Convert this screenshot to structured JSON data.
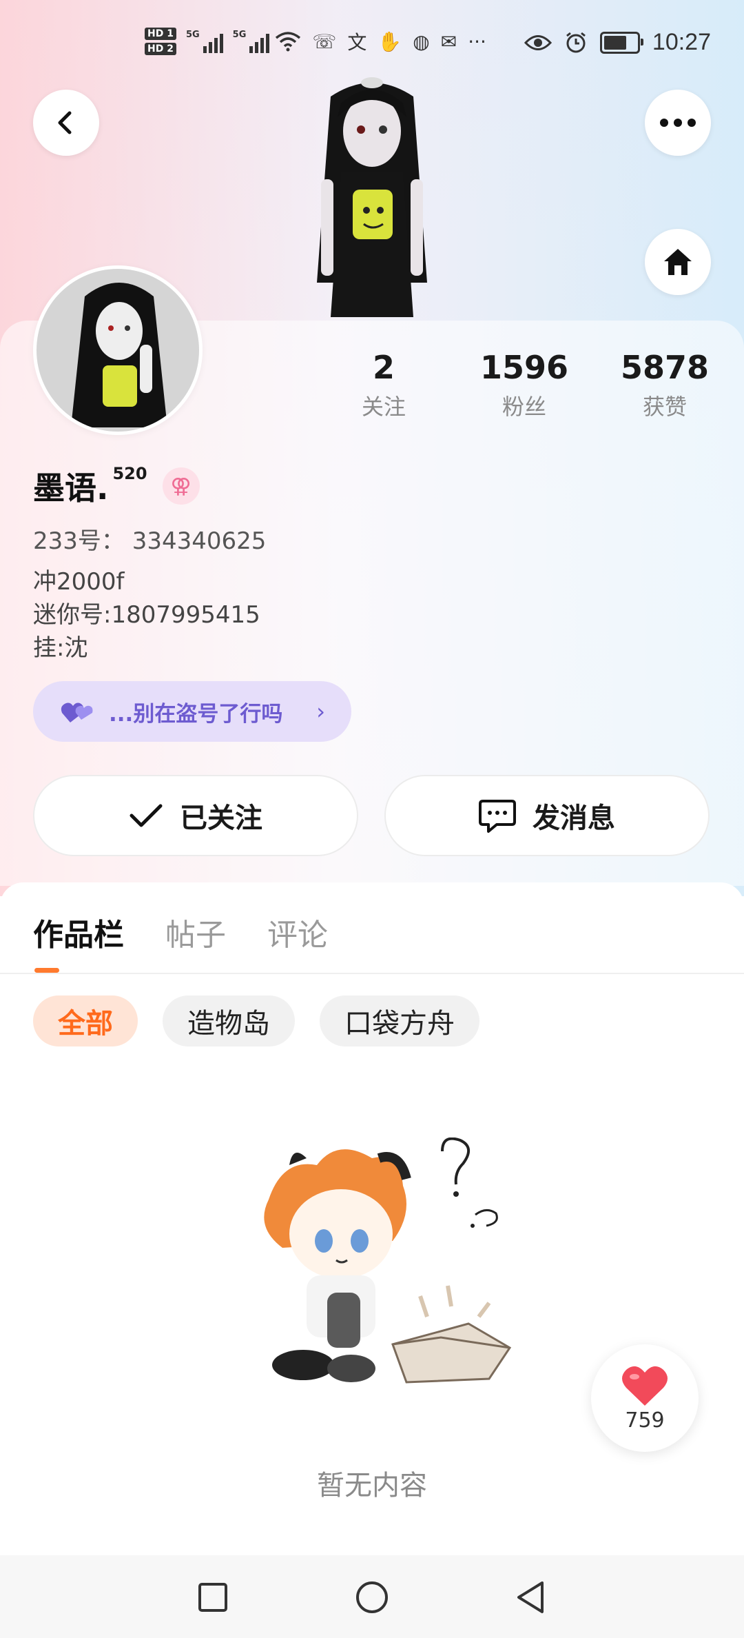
{
  "status_bar": {
    "hd1": "HD 1",
    "hd2": "HD 2",
    "net1": "5G",
    "net2": "5G",
    "more": "···",
    "time": "10:27",
    "battery_level": 0.8
  },
  "header": {
    "back_icon": "chevron-left-icon",
    "more_icon": "more-horizontal-icon",
    "home_icon": "home-icon"
  },
  "profile": {
    "stats": [
      {
        "value": "2",
        "label": "关注"
      },
      {
        "value": "1596",
        "label": "粉丝"
      },
      {
        "value": "5878",
        "label": "获赞"
      }
    ],
    "name": "墨语.",
    "name_sup": "520",
    "gender_icon": "female-symbol-icon",
    "uid": "233号：  334340625",
    "bio_lines": [
      "冲2000f",
      "迷你号:1807995415",
      "挂:沈"
    ],
    "tag": {
      "text": "...别在盗号了行吗",
      "icon": "heart-pair-icon"
    }
  },
  "actions": {
    "follow_label": "已关注",
    "message_label": "发消息"
  },
  "tabs": [
    {
      "label": "作品栏",
      "active": true
    },
    {
      "label": "帖子",
      "active": false
    },
    {
      "label": "评论",
      "active": false
    }
  ],
  "filters": [
    {
      "label": "全部",
      "active": true
    },
    {
      "label": "造物岛",
      "active": false
    },
    {
      "label": "口袋方舟",
      "active": false
    }
  ],
  "empty_state": {
    "text": "暂无内容"
  },
  "like_float": {
    "count": "759"
  },
  "colors": {
    "accent": "#ff7a2e",
    "tag_bg": "#e6defa",
    "tag_text": "#6d5bd0",
    "like_red": "#f24a5a"
  }
}
